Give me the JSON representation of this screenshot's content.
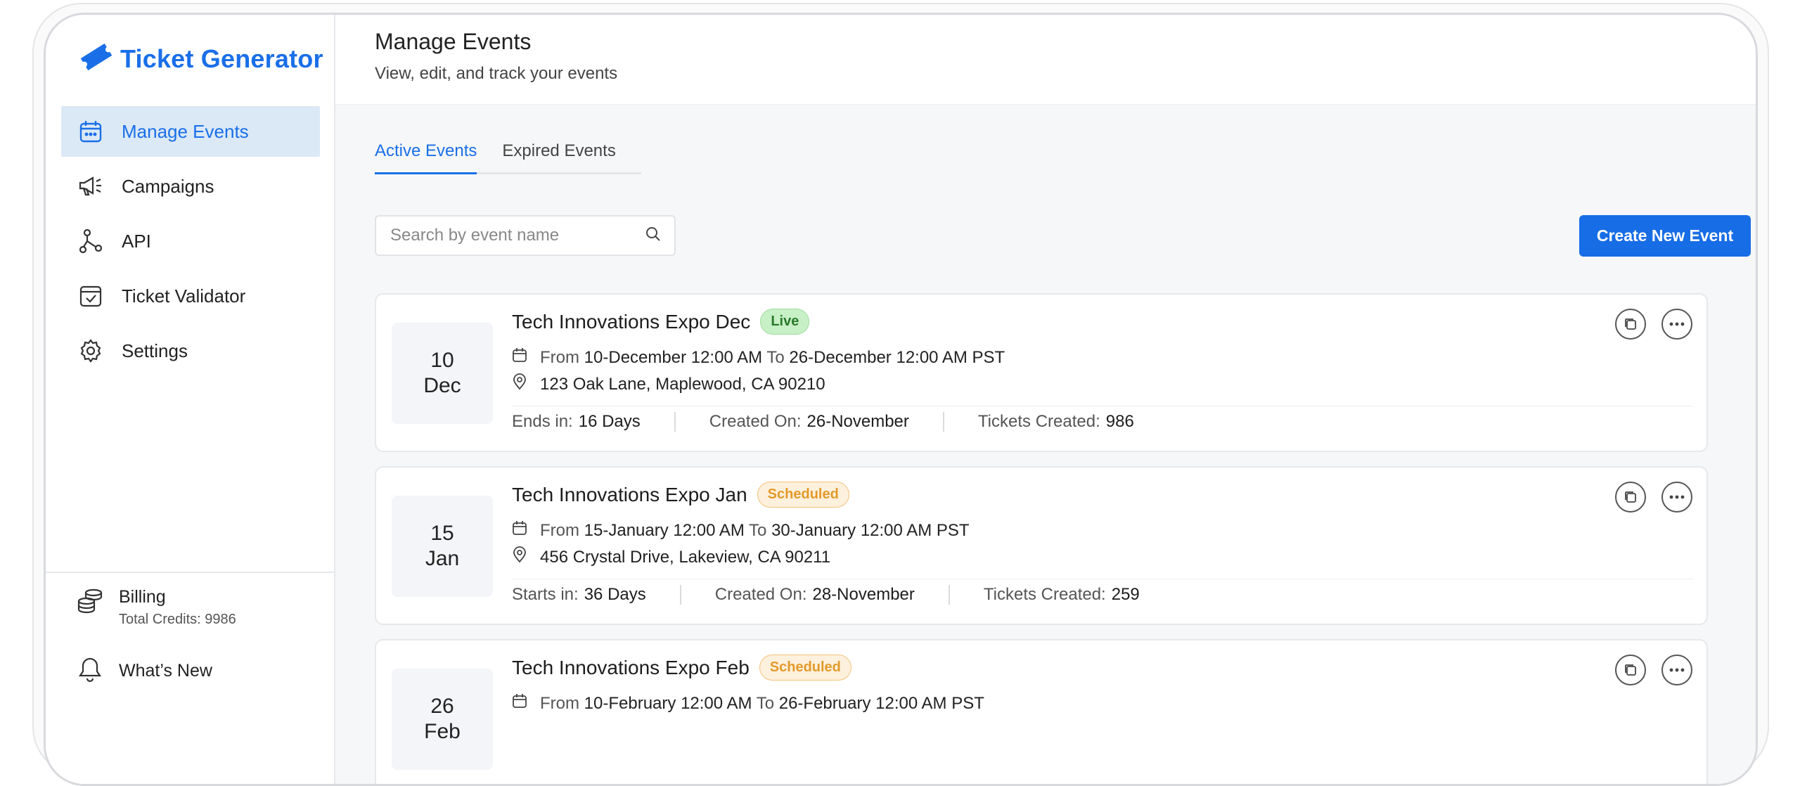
{
  "app": {
    "name": "Ticket Generator",
    "brand_color": "#1a6fe8"
  },
  "sidebar": {
    "items": [
      {
        "label": "Manage Events",
        "icon": "calendar-icon",
        "active": true
      },
      {
        "label": "Campaigns",
        "icon": "megaphone-icon"
      },
      {
        "label": "API",
        "icon": "api-nodes-icon"
      },
      {
        "label": "Ticket Validator",
        "icon": "validator-icon"
      },
      {
        "label": "Settings",
        "icon": "gear-icon"
      }
    ],
    "billing": {
      "title": "Billing",
      "credits": "Total Credits: 9986",
      "icon": "coins-icon"
    },
    "whats_new": {
      "label": "What’s New",
      "icon": "bell-icon"
    }
  },
  "header": {
    "title": "Manage Events",
    "subtitle": "View, edit, and track your events"
  },
  "tabs": [
    {
      "label": "Active Events",
      "active": true
    },
    {
      "label": "Expired Events"
    }
  ],
  "search": {
    "placeholder": "Search by event name",
    "value": ""
  },
  "actions": {
    "create_label": "Create New Event"
  },
  "labels": {
    "from": "From",
    "to": "To"
  },
  "events": [
    {
      "day": "10",
      "month": "Dec",
      "title": "Tech Innovations Expo Dec",
      "status": "Live",
      "from": "10-December 12:00 AM",
      "to": "26-December 12:00 AM PST",
      "address": "123 Oak Lane, Maplewood, CA 90210",
      "countdown_label": "Ends in:",
      "countdown_value": "16 Days",
      "created_label": "Created On:",
      "created_value": "26-November",
      "tickets_label": "Tickets Created:",
      "tickets_value": "986"
    },
    {
      "day": "15",
      "month": "Jan",
      "title": "Tech Innovations Expo Jan",
      "status": "Scheduled",
      "from": "15-January 12:00 AM",
      "to": "30-January 12:00 AM PST",
      "address": "456 Crystal Drive, Lakeview, CA 90211",
      "countdown_label": "Starts in:",
      "countdown_value": "36 Days",
      "created_label": "Created On:",
      "created_value": "28-November",
      "tickets_label": "Tickets Created:",
      "tickets_value": "259"
    },
    {
      "day": "26",
      "month": "Feb",
      "title": "Tech Innovations Expo Feb",
      "status": "Scheduled",
      "from": "10-February 12:00 AM",
      "to": "26-February 12:00 AM PST"
    }
  ]
}
